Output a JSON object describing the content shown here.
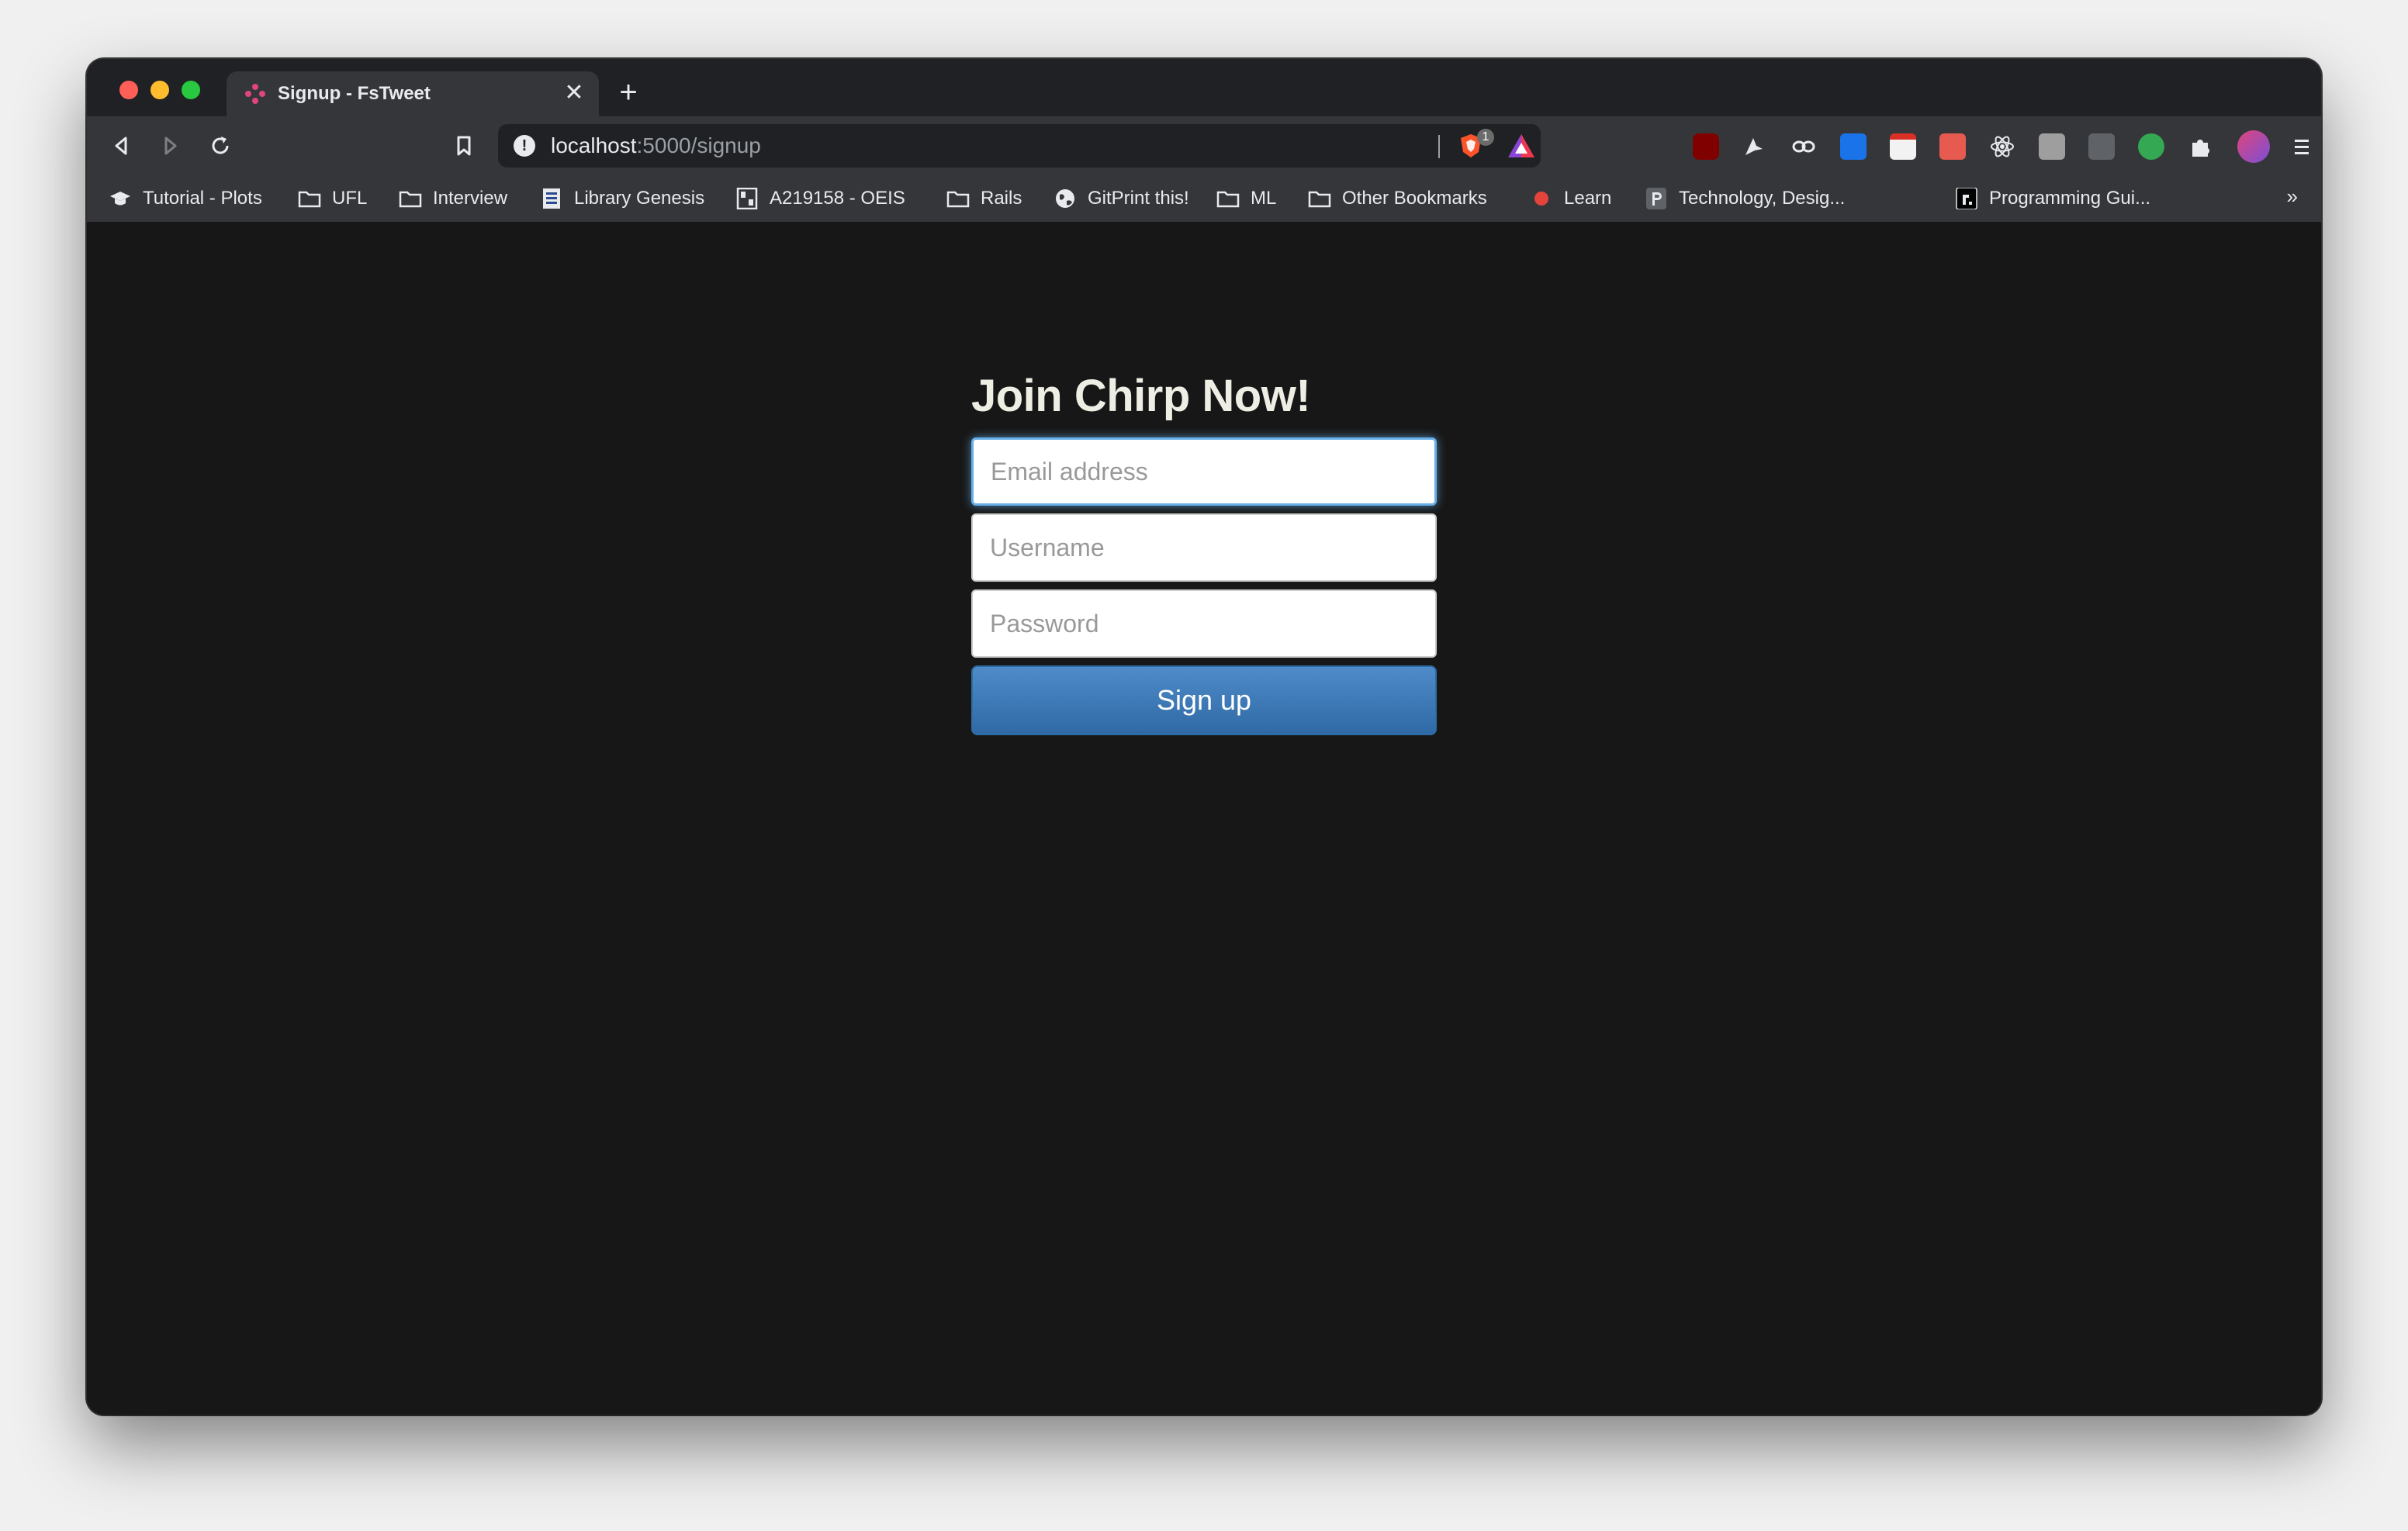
{
  "browser": {
    "tab": {
      "title": "Signup - FsTweet",
      "close_glyph": "✕"
    },
    "new_tab_glyph": "+",
    "url": {
      "host": "localhost",
      "path": ":5000/signup"
    },
    "shields_count": "1",
    "bookmarks": [
      {
        "label": "Tutorial - Plots",
        "icon": "graduation-cap-icon"
      },
      {
        "label": "UFL",
        "icon": "folder-icon"
      },
      {
        "label": "Interview",
        "icon": "folder-icon"
      },
      {
        "label": "Library Genesis",
        "icon": "library-genesis-icon"
      },
      {
        "label": "A219158 - OEIS",
        "icon": "oeis-icon"
      },
      {
        "label": "Rails",
        "icon": "folder-icon"
      },
      {
        "label": "GitPrint this!",
        "icon": "globe-icon"
      },
      {
        "label": "ML",
        "icon": "folder-icon"
      },
      {
        "label": "Other Bookmarks",
        "icon": "folder-icon"
      },
      {
        "label": "Learn",
        "icon": "red-dot-icon"
      },
      {
        "label": "Technology, Desig...",
        "icon": "p-logo-icon"
      },
      {
        "label": "Programming Gui...",
        "icon": "r-logo-icon"
      }
    ],
    "bookmarks_overflow": "»"
  },
  "page": {
    "heading": "Join Chirp Now!",
    "email_placeholder": "Email address",
    "username_placeholder": "Username",
    "password_placeholder": "Password",
    "submit_label": "Sign up"
  },
  "colors": {
    "page_bg": "#171717",
    "heading": "#eeeee4",
    "button": "#337ab7"
  }
}
